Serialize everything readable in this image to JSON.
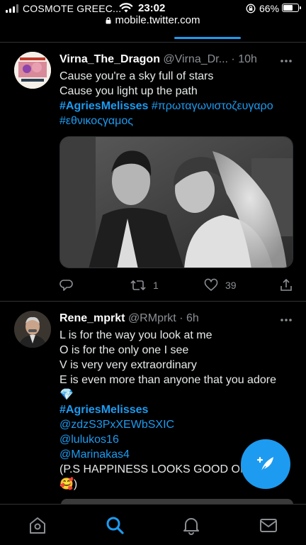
{
  "status_bar": {
    "carrier": "COSMOTE GREEC...",
    "time": "23:02",
    "battery": "66%",
    "battery_level": 0.66
  },
  "browser": {
    "url": "mobile.twitter.com"
  },
  "tweets": [
    {
      "display_name": "Virna_The_Dragon",
      "handle": "@Virna_Dr...",
      "time": "10h",
      "lines": [
        "Cause you're a sky full of stars",
        "Cause you light up the path"
      ],
      "hashtag_main": "#AgriesMelisses",
      "hashtag_2": "#πρωταγωνιστοζευγαρο",
      "hashtag_3": "#εθνικοςγαμος",
      "retweets": "1",
      "likes": "39"
    },
    {
      "display_name": "Rene_mprkt",
      "handle": "@RMprkt",
      "time": "6h",
      "lines": [
        "L is for the way you look at me",
        "O is for the only one I see",
        "V is very very extraordinary",
        "E is even more than anyone that you adore"
      ],
      "emoji_1": "💎",
      "hashtag_main": "#AgriesMelisses",
      "mentions": [
        "@zdzS3PxXEWbSXIC",
        "@lulukos16",
        "@Marinakas4"
      ],
      "ps": "(P.S HAPPINESS LOOKS GOOD ON",
      "emoji_2": "🥰",
      "closing": ")"
    }
  ],
  "colors": {
    "accent": "#1d9bf0",
    "background": "#000000",
    "divider": "#2f3336",
    "secondary_text": "#8b8f94"
  },
  "icons": {
    "status": [
      "signal-icon",
      "wifi-icon",
      "orientation-lock-icon",
      "battery-icon"
    ],
    "tweet_actions": [
      "reply-icon",
      "retweet-icon",
      "like-icon",
      "share-icon"
    ],
    "nav": [
      "home-icon",
      "search-icon",
      "notifications-icon",
      "messages-icon"
    ],
    "fab": "compose-icon"
  }
}
